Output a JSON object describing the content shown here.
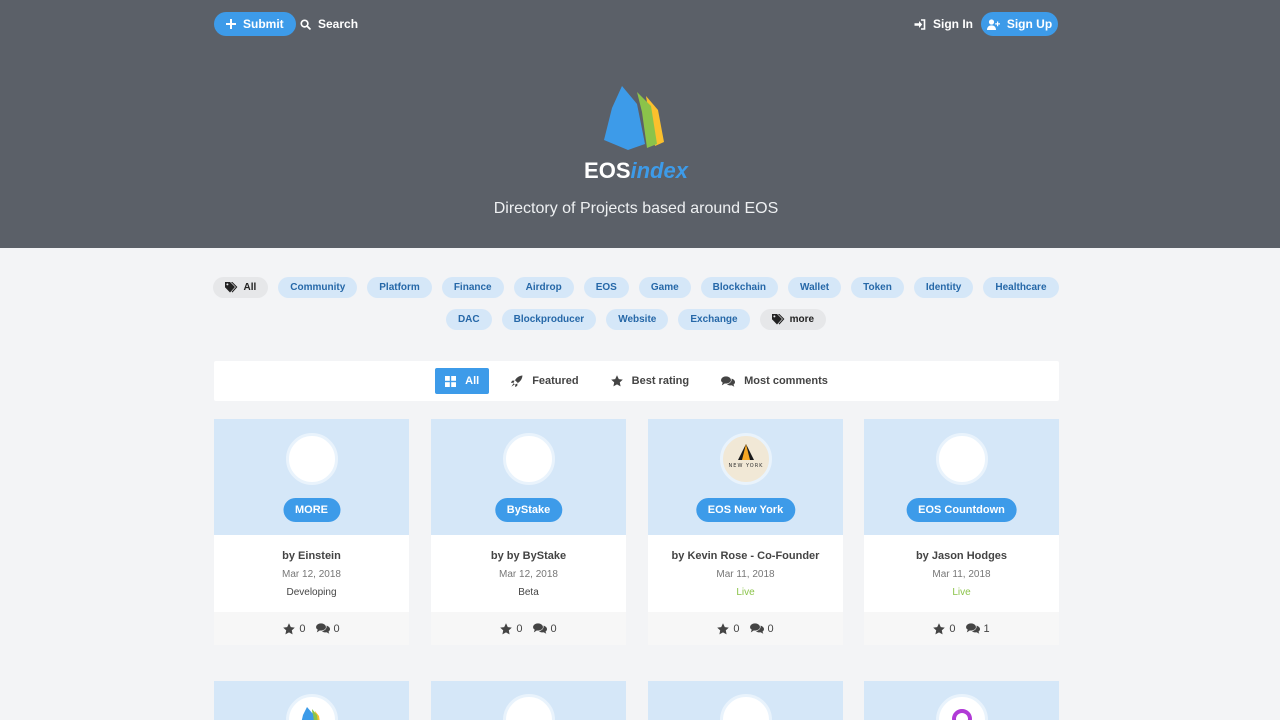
{
  "nav": {
    "submit_label": "Submit",
    "search_label": "Search",
    "signin_label": "Sign In",
    "signup_label": "Sign Up"
  },
  "hero": {
    "brand_main": "EOS",
    "brand_accent": "index",
    "tagline": "Directory of Projects based around EOS"
  },
  "tags": {
    "row1": [
      "All",
      "Community",
      "Platform",
      "Finance",
      "Airdrop",
      "EOS",
      "Game",
      "Blockchain",
      "Wallet",
      "Token",
      "Identity",
      "Healthcare"
    ],
    "row2": [
      "DAC",
      "Blockproducer",
      "Website",
      "Exchange",
      "more"
    ]
  },
  "filters": [
    "All",
    "Featured",
    "Best rating",
    "Most comments"
  ],
  "projects": [
    {
      "name": "MORE",
      "author": "by Einstein",
      "date": "Mar 12, 2018",
      "status": "Developing",
      "rating": "0",
      "comments": "0"
    },
    {
      "name": "ByStake",
      "author": "by by ByStake",
      "date": "Mar 12, 2018",
      "status": "Beta",
      "rating": "0",
      "comments": "0"
    },
    {
      "name": "EOS New York",
      "author": "by Kevin Rose - Co-Founder",
      "date": "Mar 11, 2018",
      "status": "Live",
      "rating": "0",
      "comments": "0",
      "logo_text": "NEW YORK"
    },
    {
      "name": "EOS Countdown",
      "author": "by Jason Hodges",
      "date": "Mar 11, 2018",
      "status": "Live",
      "rating": "0",
      "comments": "1"
    }
  ],
  "colors": {
    "hero_bg": "#5b6068",
    "accent": "#3d9be9",
    "tag_bg": "#d5e7f8",
    "live_status": "#8bc34a",
    "logo_blue": "#3d9be9",
    "logo_green": "#8bc34a",
    "logo_yellow": "#fbc02d"
  }
}
